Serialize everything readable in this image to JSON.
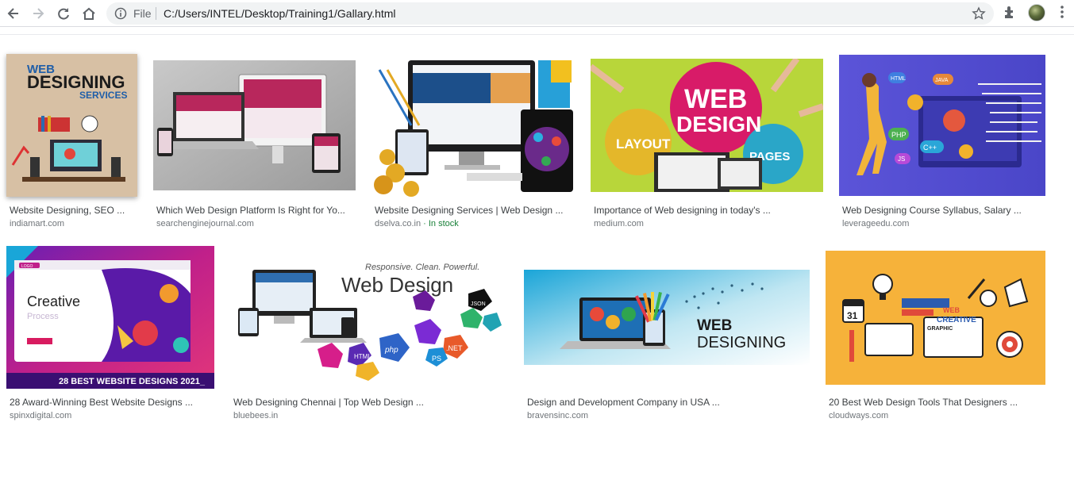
{
  "browser": {
    "scheme": "File",
    "url": "C:/Users/INTEL/Desktop/Training1/Gallary.html",
    "icons": [
      "back-icon",
      "forward-icon",
      "reload-icon",
      "home-icon",
      "info-icon",
      "star-icon",
      "extensions-icon",
      "profile-avatar",
      "menu-kebab-icon"
    ]
  },
  "thumbnails": {
    "t1": {
      "line1": "WEB",
      "line2": "DESIGNING",
      "line3": "SERVICES"
    },
    "t6": {
      "heading": "Creative",
      "sub": "Process",
      "banner": "28 BEST WEBSITE DESIGNS 2021_",
      "logo": "LOGO"
    },
    "t7": {
      "tagline": "Responsive. Clean. Powerful.",
      "heading": "Web Design",
      "tags": [
        "HTML",
        "php",
        ".NET",
        "JSON",
        "PS"
      ]
    },
    "t8": {
      "line1": "WEB",
      "line2": "DESIGNING"
    },
    "t4": {
      "line1": "WEB",
      "line2": "DESIGN",
      "left": "LAYOUT",
      "right": "PAGES"
    },
    "t5": {
      "tags": [
        "HTML",
        "JAVA",
        "PHP",
        "JS",
        "C++"
      ]
    },
    "t10": {
      "calendar": "31",
      "web": "WEB",
      "creative": "CREATIVE",
      "graphic": "GRAPHIC"
    }
  },
  "results": [
    {
      "title": "Website Designing, SEO ...",
      "source": "indiamart.com",
      "stock": ""
    },
    {
      "title": "Which Web Design Platform Is Right for Yo...",
      "source": "searchenginejournal.com",
      "stock": ""
    },
    {
      "title": "Website Designing Services | Web Design ...",
      "source": "dselva.co.in",
      "stock": " · In stock"
    },
    {
      "title": "Importance of Web designing in today's ...",
      "source": "medium.com",
      "stock": ""
    },
    {
      "title": "Web Designing Course Syllabus, Salary ...",
      "source": "leverageedu.com",
      "stock": ""
    },
    {
      "title": "28 Award-Winning Best Website Designs ...",
      "source": "spinxdigital.com",
      "stock": ""
    },
    {
      "title": "Web Designing Chennai | Top Web Design ...",
      "source": "bluebees.in",
      "stock": ""
    },
    {
      "title": "Design and Development Company in USA ...",
      "source": "bravensinc.com",
      "stock": ""
    },
    {
      "title": "20 Best Web Design Tools That Designers ...",
      "source": "cloudways.com",
      "stock": ""
    }
  ]
}
